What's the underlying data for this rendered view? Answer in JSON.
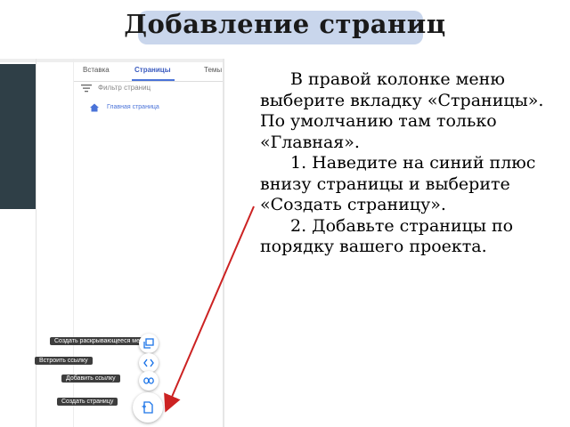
{
  "title": "Добавление страниц",
  "sites_ui": {
    "tabs": [
      "Вставка",
      "Страницы",
      "Темы"
    ],
    "active_tab": "Страницы",
    "filter_placeholder": "Фильтр страниц",
    "page_items": [
      "Главная страница"
    ],
    "fab_menu": [
      {
        "tooltip": "Создать раскрывающееся меню",
        "icon": "copy-icon"
      },
      {
        "tooltip": "Встроить ссылку",
        "icon": "code-icon"
      },
      {
        "tooltip": "Добавить ссылку",
        "icon": "link-icon"
      },
      {
        "tooltip": "Создать страницу",
        "icon": "new-page-icon"
      }
    ]
  },
  "instructions": [
    "В правой колонке меню выберите вкладку «Страницы». По умолчанию там только «Главная».",
    "1.  Наведите на синий плюс внизу страницы и выберите «Создать страницу».",
    "2.  Добавьте страницы по порядку вашего проекта."
  ],
  "colors": {
    "title_highlight": "#c9d6ec",
    "arrow": "#cc2222",
    "tab_active": "#3b5bbf"
  }
}
